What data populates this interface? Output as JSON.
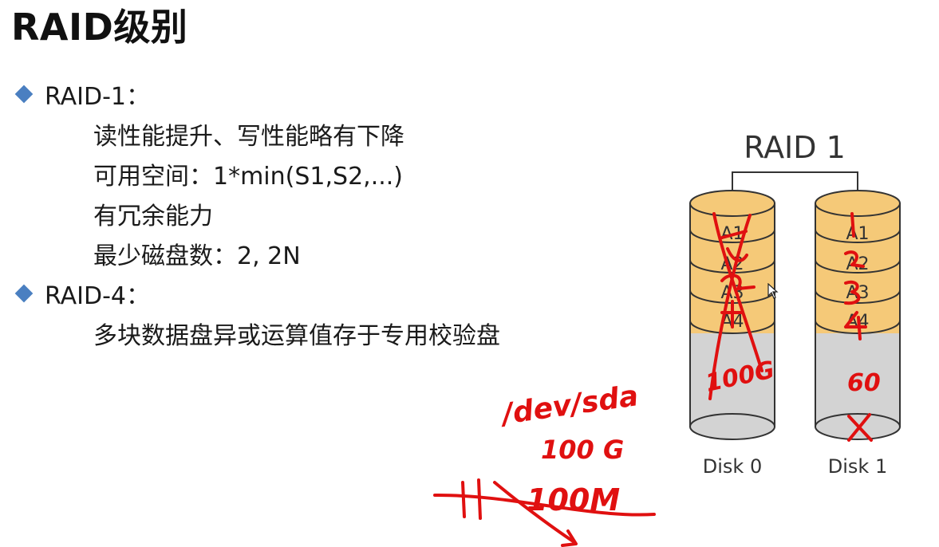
{
  "slide": {
    "title": "RAID级别",
    "sections": [
      {
        "heading": "RAID-1：",
        "lines": [
          "读性能提升、写性能略有下降",
          "可用空间：1*min(S1,S2,...)",
          "有冗余能力",
          "最少磁盘数：2, 2N"
        ]
      },
      {
        "heading": "RAID-4：",
        "lines": [
          "多块数据盘异或运算值存于专用校验盘"
        ]
      }
    ]
  },
  "diagram": {
    "title": "RAID 1",
    "disks": [
      {
        "label": "Disk 0",
        "blocks": [
          "A1",
          "A2",
          "A3",
          "A4"
        ]
      },
      {
        "label": "Disk 1",
        "blocks": [
          "A1",
          "A2",
          "A3",
          "A4"
        ]
      }
    ],
    "colors": {
      "block_fill": "#f5c978",
      "disk_fill": "#d3d3d3",
      "outline": "#333333",
      "bullet": "#4a7fc1",
      "annotation": "#e01010"
    }
  },
  "annotations": {
    "disk0_size": "100G",
    "disk1_size": "60",
    "disk1_mark": "X",
    "device_path": "/dev/sda",
    "device_size": "100 G",
    "bottom_note": "100M"
  }
}
